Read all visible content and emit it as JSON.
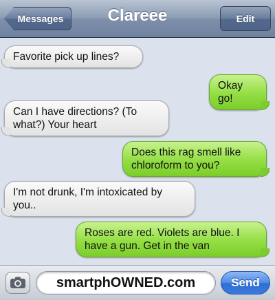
{
  "navbar": {
    "back_label": "Messages",
    "title": "Clareee",
    "edit_label": "Edit"
  },
  "messages": [
    {
      "direction": "incoming",
      "text": "Favorite pick up lines?"
    },
    {
      "direction": "outgoing",
      "text": "Okay go!"
    },
    {
      "direction": "incoming",
      "text": "Can I have directions? (To what?) Your heart"
    },
    {
      "direction": "outgoing",
      "text": "Does this rag smell like chloroform to you?"
    },
    {
      "direction": "incoming",
      "text": "I'm not drunk, I'm intoxicated by you.."
    },
    {
      "direction": "outgoing",
      "text": "Roses are red. Violets are blue. I have a gun. Get in the van"
    }
  ],
  "composer": {
    "input_value": "smartphOWNED.com",
    "send_label": "Send",
    "camera_icon": "camera-icon"
  },
  "colors": {
    "incoming_bubble": "#e8e8e8",
    "outgoing_bubble": "#93de43",
    "navbar": "#7e8faa",
    "send_button": "#3a78dc",
    "background": "#dbe2ed"
  }
}
